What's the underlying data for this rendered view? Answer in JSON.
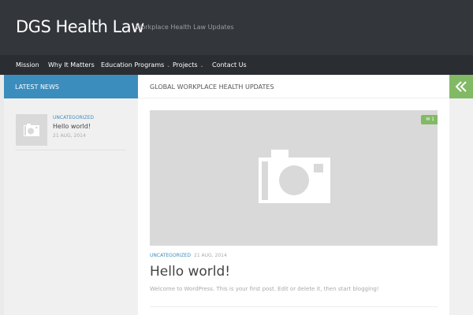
{
  "site": {
    "title": "DGS Health Law",
    "description": "Workplace Health Law Updates"
  },
  "nav": {
    "items": [
      {
        "label": "Mission",
        "has_submenu": false
      },
      {
        "label": "Why It Matters",
        "has_submenu": false
      },
      {
        "label": "Education Programs",
        "has_submenu": true
      },
      {
        "label": "Projects",
        "has_submenu": true
      },
      {
        "label": "Contact Us",
        "has_submenu": false
      }
    ],
    "caret": "⌄"
  },
  "sidebar": {
    "heading": "LATEST NEWS",
    "posts": [
      {
        "category": "UNCATEGORIZED",
        "title": "Hello world!",
        "date": "21 AUG, 2014",
        "thumb_icon": "camera-icon"
      }
    ]
  },
  "main": {
    "heading": "GLOBAL WORKPLACE HEALTH UPDATES",
    "post": {
      "comment_count": "1",
      "thumb_icon": "camera-icon",
      "category": "UNCATEGORIZED",
      "date": "21 AUG, 2014",
      "title": "Hello world!",
      "excerpt": "Welcome to WordPress. This is your first post. Edit or delete it, then start blogging!"
    }
  },
  "sidebar_toggle": {
    "icon": "double-chevron-left-icon"
  },
  "colors": {
    "header": "#33363b",
    "nav": "#2a2d31",
    "accent_blue": "#3b8dbd",
    "accent_green": "#82b965",
    "placeholder": "#d9d9d9"
  }
}
